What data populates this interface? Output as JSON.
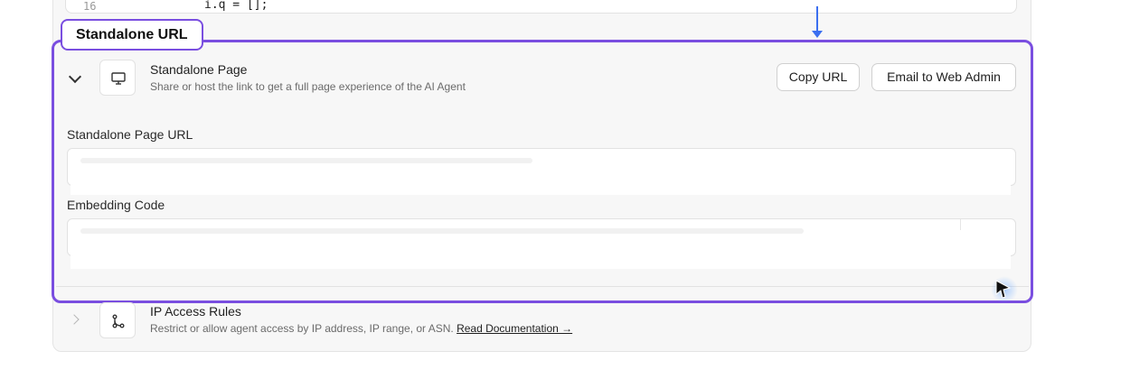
{
  "code_snippet": {
    "line_number": "16",
    "code": "i.q = [];"
  },
  "annotation": {
    "tag_label": "Standalone URL",
    "accent_color": "#7a4ee0",
    "arrow_color": "#3b6ff0"
  },
  "standalone": {
    "icon": "monitor-icon",
    "title": "Standalone Page",
    "description": "Share or host the link to get a full page experience of the AI Agent",
    "copy_button": "Copy URL",
    "email_button": "Email to Web Admin",
    "url_field_label": "Standalone Page URL",
    "embed_field_label": "Embedding Code"
  },
  "ip_rules": {
    "icon": "git-branch-icon",
    "title": "IP Access Rules",
    "description": "Restrict or allow agent access by IP address, IP range, or ASN.",
    "link_text": "Read Documentation →"
  }
}
